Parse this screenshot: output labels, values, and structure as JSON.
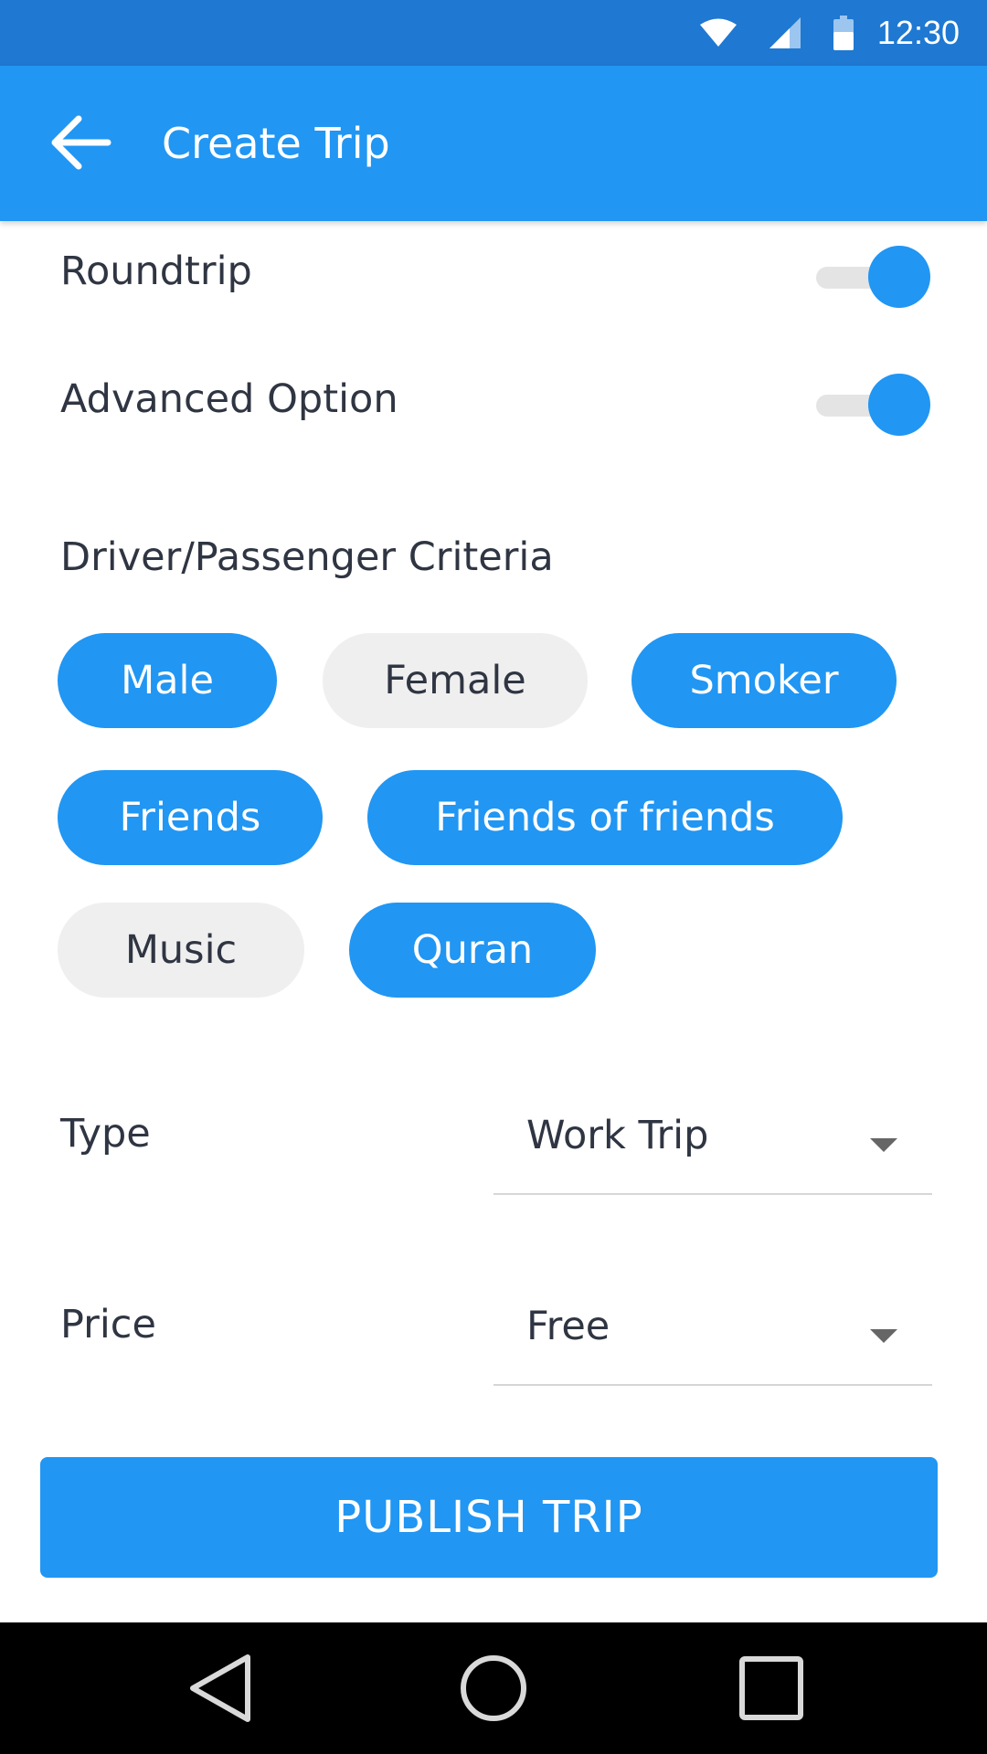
{
  "status_bar": {
    "time": "12:30"
  },
  "app_bar": {
    "title": "Create Trip"
  },
  "settings": {
    "roundtrip": {
      "label": "Roundtrip",
      "enabled": true
    },
    "advanced": {
      "label": "Advanced Option",
      "enabled": true
    }
  },
  "criteria": {
    "title": "Driver/Passenger Criteria",
    "chips": [
      {
        "label": "Male",
        "selected": true
      },
      {
        "label": "Female",
        "selected": false
      },
      {
        "label": "Smoker",
        "selected": true
      },
      {
        "label": "Friends",
        "selected": true
      },
      {
        "label": "Friends of friends",
        "selected": true
      },
      {
        "label": "Music",
        "selected": false
      },
      {
        "label": "Quran",
        "selected": true
      }
    ]
  },
  "fields": {
    "type": {
      "label": "Type",
      "value": "Work Trip"
    },
    "price": {
      "label": "Price",
      "value": "Free"
    }
  },
  "actions": {
    "publish_label": "PUBLISH TRIP"
  },
  "colors": {
    "primary": "#2196f3",
    "status_bar": "#1f78d1",
    "chip_off": "#efefef",
    "text": "#2f3542"
  },
  "icons": {
    "status": [
      "wifi-icon",
      "signal-icon",
      "battery-icon"
    ],
    "app_bar": "arrow-back-icon",
    "nav": [
      "nav-back-icon",
      "nav-home-icon",
      "nav-recents-icon"
    ]
  }
}
